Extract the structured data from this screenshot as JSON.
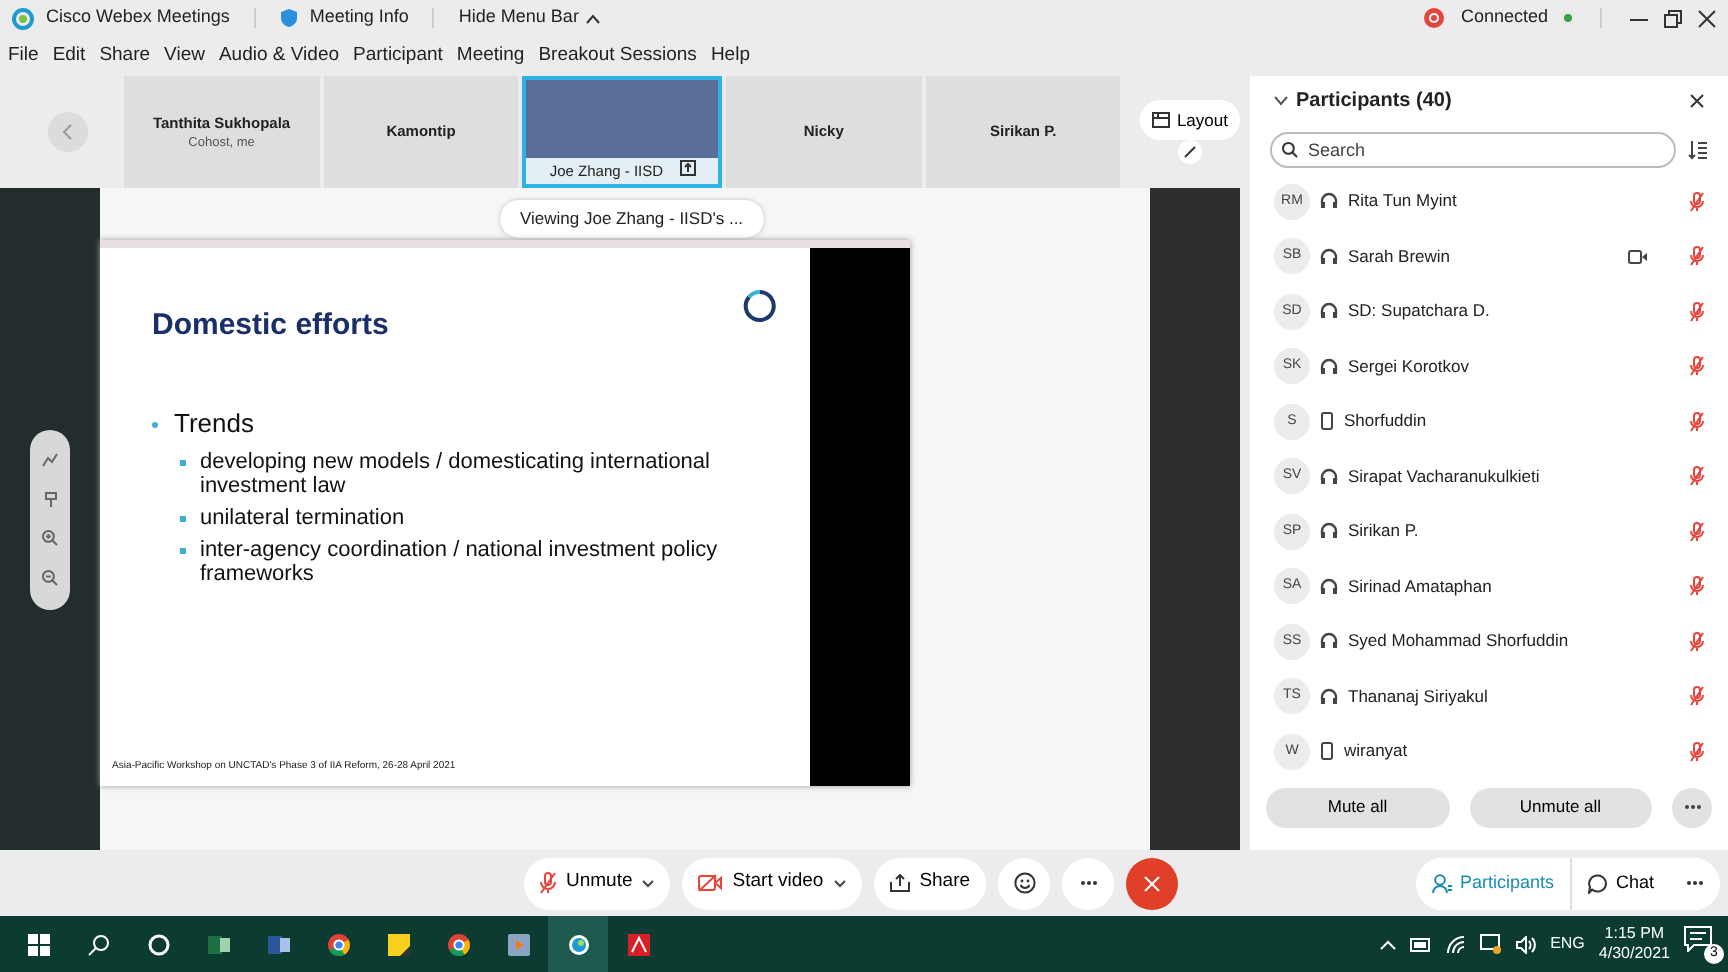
{
  "title_bar": {
    "app_name": "Cisco Webex Meetings",
    "meeting_info": "Meeting Info",
    "hide_menu": "Hide Menu Bar",
    "status": "Connected"
  },
  "menu": [
    "File",
    "Edit",
    "Share",
    "View",
    "Audio & Video",
    "Participant",
    "Meeting",
    "Breakout Sessions",
    "Help"
  ],
  "thumbnails": [
    {
      "name": "Tanthita Sukhopala",
      "subtitle": "Cohost, me",
      "kind": "tile",
      "selected": false
    },
    {
      "name": "Kamontip",
      "kind": "tile",
      "selected": false
    },
    {
      "name": "Joe Zhang - IISD",
      "kind": "video",
      "selected": true
    },
    {
      "name": "Nicky",
      "kind": "tile",
      "selected": false
    },
    {
      "name": "Sirikan P.",
      "kind": "tile",
      "selected": false
    }
  ],
  "layout_button": "Layout",
  "stage": {
    "viewing_label": "Viewing Joe Zhang - IISD's ...",
    "slide": {
      "title": "Domestic efforts",
      "bullets": [
        {
          "text": "Trends",
          "children": [
            {
              "text": "developing new models / domesticating international investment law"
            },
            {
              "text": "unilateral termination"
            },
            {
              "text": "inter-agency coordination / national investment policy frameworks"
            }
          ]
        }
      ],
      "footer": "Asia-Pacific Workshop on UNCTAD's Phase 3 of IIA Reform, 26-28 April 2021"
    }
  },
  "participants": {
    "title": "Participants (40)",
    "search_placeholder": "Search",
    "rows": [
      {
        "initials": "RM",
        "name": "Rita Tun Myint",
        "kind": "computer",
        "video": false,
        "muted": true
      },
      {
        "initials": "SB",
        "name": "Sarah Brewin",
        "kind": "computer",
        "video": true,
        "muted": true
      },
      {
        "initials": "SD",
        "name": "SD: Supatchara D.",
        "kind": "computer",
        "video": false,
        "muted": true
      },
      {
        "initials": "SK",
        "name": "Sergei Korotkov",
        "kind": "computer",
        "video": false,
        "muted": true
      },
      {
        "initials": "S",
        "name": "Shorfuddin",
        "kind": "phone",
        "video": false,
        "muted": true
      },
      {
        "initials": "SV",
        "name": "Sirapat Vacharanukulkieti",
        "kind": "computer",
        "video": false,
        "muted": true
      },
      {
        "initials": "SP",
        "name": "Sirikan P.",
        "kind": "computer",
        "video": false,
        "muted": true
      },
      {
        "initials": "SA",
        "name": "Sirinad Amataphan",
        "kind": "computer",
        "video": false,
        "muted": true
      },
      {
        "initials": "SS",
        "name": "Syed Mohammad Shorfuddin",
        "kind": "computer",
        "video": false,
        "muted": true
      },
      {
        "initials": "TS",
        "name": "Thananaj Siriyakul",
        "kind": "computer",
        "video": false,
        "muted": true
      },
      {
        "initials": "W",
        "name": "wiranyat",
        "kind": "phone",
        "video": false,
        "muted": true
      }
    ],
    "buttons": [
      "Mute all",
      "Unmute all"
    ]
  },
  "controls": [
    {
      "kind": "mic",
      "label": "Unmute",
      "dropdown": true
    },
    {
      "kind": "video",
      "label": "Start video",
      "dropdown": true
    },
    {
      "kind": "share",
      "label": "Share",
      "dropdown": false
    },
    {
      "kind": "reaction",
      "dropdown": false
    },
    {
      "kind": "more",
      "dropdown": false
    },
    {
      "kind": "end",
      "dropdown": false
    }
  ],
  "panel_tabs": [
    {
      "label": "Participants",
      "selected": true
    },
    {
      "label": "Chat",
      "selected": false
    }
  ],
  "taskbar": {
    "apps": [
      {
        "kind": "start",
        "active": false
      },
      {
        "kind": "search",
        "active": false
      },
      {
        "kind": "cortana",
        "active": false
      },
      {
        "kind": "excel",
        "active": false
      },
      {
        "kind": "word",
        "active": false
      },
      {
        "kind": "chrome",
        "active": false
      },
      {
        "kind": "notes",
        "active": false
      },
      {
        "kind": "chrome",
        "active": false
      },
      {
        "kind": "media",
        "active": false
      },
      {
        "kind": "webex",
        "active": true
      },
      {
        "kind": "acrobat",
        "active": false
      }
    ],
    "language": "ENG",
    "time": "1:15 PM",
    "date": "4/30/2021",
    "notifications": "3"
  }
}
